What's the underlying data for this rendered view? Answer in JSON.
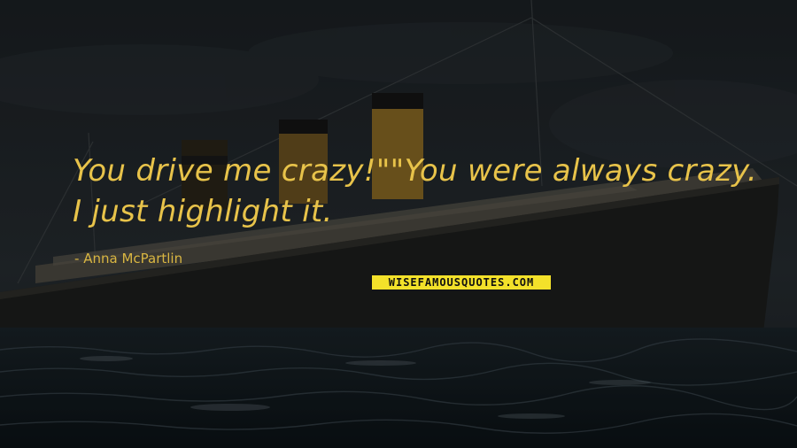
{
  "quote": {
    "line1": "You drive me crazy!\"\"You were always crazy.",
    "line2": "I just highlight it."
  },
  "author": {
    "prefix": "-",
    "name": "Anna McPartlin"
  },
  "brand": {
    "text": "WISEFAMOUSQUOTES.COM"
  },
  "colors": {
    "quote_text": "#e8c34a",
    "brand_bg": "#f3e12a",
    "sky": "#20262b",
    "sea": "#121a20"
  }
}
